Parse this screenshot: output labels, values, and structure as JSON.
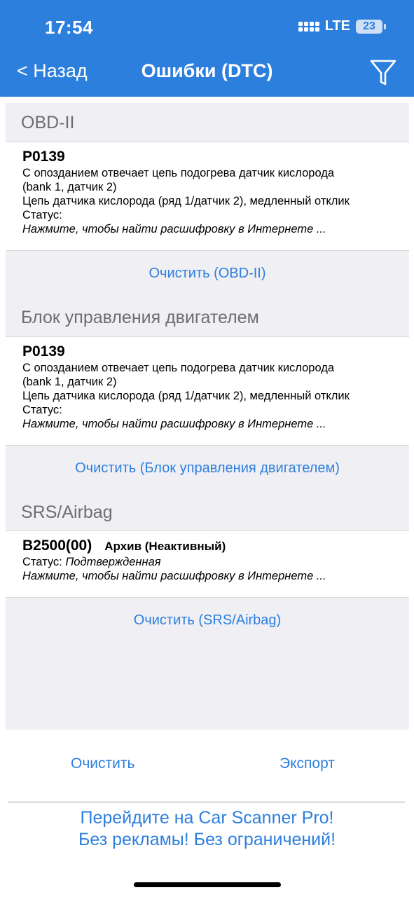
{
  "status_bar": {
    "time": "17:54",
    "network": "LTE",
    "battery": "23"
  },
  "nav": {
    "back_label": "< Назад",
    "title": "Ошибки (DTC)"
  },
  "sections": [
    {
      "header": "OBD-II",
      "code": "P0139",
      "desc_line1": "С опозданием отвечает цепь подогрева датчик кислорода",
      "desc_line2": "(bank 1, датчик 2)",
      "desc_line3": "Цепь датчика кислорода (ряд 1/датчик 2), медленный отклик",
      "status_label": "Статус:",
      "lookup": "Нажмите, чтобы найти расшифровку в Интернете ...",
      "clear_label": "Очистить (OBD-II)"
    },
    {
      "header": "Блок управления двигателем",
      "code": "P0139",
      "desc_line1": "С опозданием отвечает цепь подогрева датчик кислорода",
      "desc_line2": "(bank 1, датчик 2)",
      "desc_line3": "Цепь датчика кислорода (ряд 1/датчик 2), медленный отклик",
      "status_label": "Статус:",
      "lookup": "Нажмите, чтобы найти расшифровку в Интернете ...",
      "clear_label": "Очистить (Блок управления двигателем)"
    },
    {
      "header": "SRS/Airbag",
      "code": "B2500(00)",
      "code_state": "Архив (Неактивный)",
      "status_label": "Статус:",
      "status_value": "Подтвержденная",
      "lookup": "Нажмите, чтобы найти расшифровку в Интернете ...",
      "clear_label": "Очистить (SRS/Airbag)"
    }
  ],
  "bottom": {
    "clear_label": "Очистить",
    "export_label": "Экспорт"
  },
  "promo": {
    "line1": "Перейдите на Car Scanner Pro!",
    "line2": "Без рекламы! Без ограничений!"
  },
  "colors": {
    "accent": "#2d7fde",
    "panel_bg": "#efeff4",
    "header_text": "#6d6d72"
  },
  "icons": {
    "filter": "filter-icon",
    "signal": "cellular-signal-icon",
    "battery": "battery-icon"
  }
}
